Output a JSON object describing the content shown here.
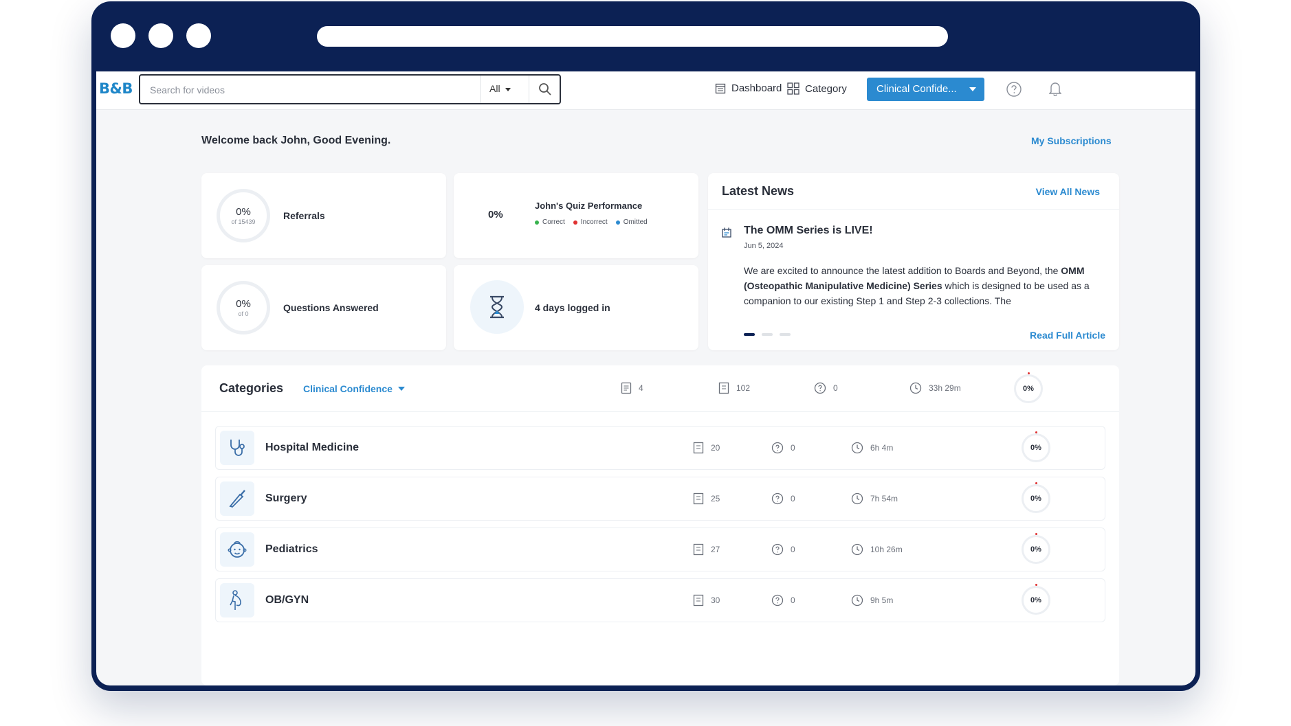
{
  "browser": {
    "window_dots": 3
  },
  "nav": {
    "logo": "B&B",
    "search_placeholder": "Search for videos",
    "search_scope": "All",
    "dashboard_label": "Dashboard",
    "category_label": "Category",
    "select_label": "Clinical Confide..."
  },
  "welcome": "Welcome back John, Good Evening.",
  "my_subscriptions": "My Subscriptions",
  "stats": {
    "referrals": {
      "pct": "0%",
      "sub": "of 15439",
      "label": "Referrals"
    },
    "quiz": {
      "pct": "0%",
      "label": "John's Quiz Performance",
      "legend": [
        "Correct",
        "Incorrect",
        "Omitted"
      ],
      "legend_colors": [
        "#37b24d",
        "#e03131",
        "#2b8ad0"
      ]
    },
    "questions": {
      "pct": "0%",
      "sub": "of 0",
      "label": "Questions Answered"
    },
    "logged": {
      "label": "4 days logged in"
    }
  },
  "news": {
    "title": "Latest News",
    "view_all": "View All News",
    "article_title": "The OMM Series is LIVE!",
    "article_date": "Jun 5, 2024",
    "body_pre": "We are excited to announce the latest addition to Boards and Beyond, the ",
    "body_bold": "OMM (Osteopathic Manipulative Medicine) Series",
    "body_post": " which is designed to be used as a companion to our existing Step 1 and Step 2-3 collections. The",
    "read_more": "Read Full Article"
  },
  "categories": {
    "title": "Categories",
    "filter": "Clinical Confidence",
    "summary": {
      "docs": "4",
      "items": "102",
      "questions": "0",
      "time": "33h 29m",
      "pct": "0%"
    },
    "rows": [
      {
        "name": "Hospital Medicine",
        "items": "20",
        "questions": "0",
        "time": "6h 4m",
        "pct": "0%",
        "icon": "stethoscope-icon"
      },
      {
        "name": "Surgery",
        "items": "25",
        "questions": "0",
        "time": "7h 54m",
        "pct": "0%",
        "icon": "scalpel-icon"
      },
      {
        "name": "Pediatrics",
        "items": "27",
        "questions": "0",
        "time": "10h 26m",
        "pct": "0%",
        "icon": "baby-face-icon"
      },
      {
        "name": "OB/GYN",
        "items": "30",
        "questions": "0",
        "time": "9h 5m",
        "pct": "0%",
        "icon": "pregnancy-icon"
      }
    ]
  },
  "colors": {
    "frame": "#0c2154",
    "accent": "#2b8ad0",
    "text": "#2a2f3a"
  }
}
